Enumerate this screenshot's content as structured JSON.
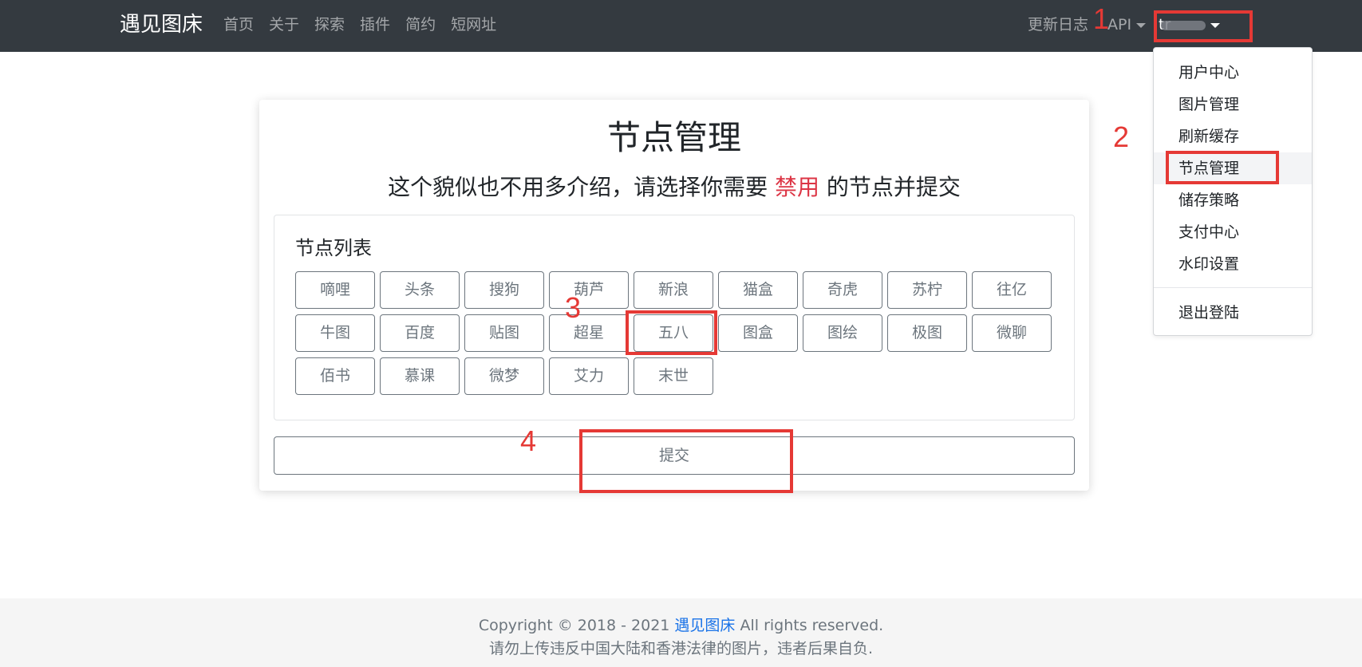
{
  "navbar": {
    "brand": "遇见图床",
    "links": [
      "首页",
      "关于",
      "探索",
      "插件",
      "简约",
      "短网址"
    ],
    "changelog": "更新日志",
    "api": "API",
    "user_name": "tr"
  },
  "dropdown": {
    "items": [
      "用户中心",
      "图片管理",
      "刷新缓存",
      "节点管理",
      "储存策略",
      "支付中心",
      "水印设置"
    ],
    "logout": "退出登陆"
  },
  "card": {
    "title": "节点管理",
    "subtitle_before": "这个貌似也不用多介绍，请选择你需要 ",
    "subtitle_highlight": "禁用",
    "subtitle_after": " 的节点并提交",
    "node_list_heading": "节点列表",
    "nodes": [
      "嘀哩",
      "头条",
      "搜狗",
      "葫芦",
      "新浪",
      "猫盒",
      "奇虎",
      "苏柠",
      "往亿",
      "牛图",
      "百度",
      "贴图",
      "超星",
      "五八",
      "图盒",
      "图绘",
      "极图",
      "微聊",
      "佰书",
      "慕课",
      "微梦",
      "艾力",
      "末世"
    ],
    "submit_label": "提交"
  },
  "footer": {
    "line1_before": "Copyright © 2018 - 2021 ",
    "line1_link": "遇见图床",
    "line1_after": " All rights reserved.",
    "line2": "请勿上传违反中国大陆和香港法律的图片，违者后果自负."
  },
  "annotations": [
    "1",
    "2",
    "3",
    "4"
  ],
  "colors": {
    "navbar_bg": "#343a40",
    "danger": "#dc3545",
    "annotation_red": "#e53935",
    "link_blue": "#1a73e8"
  }
}
